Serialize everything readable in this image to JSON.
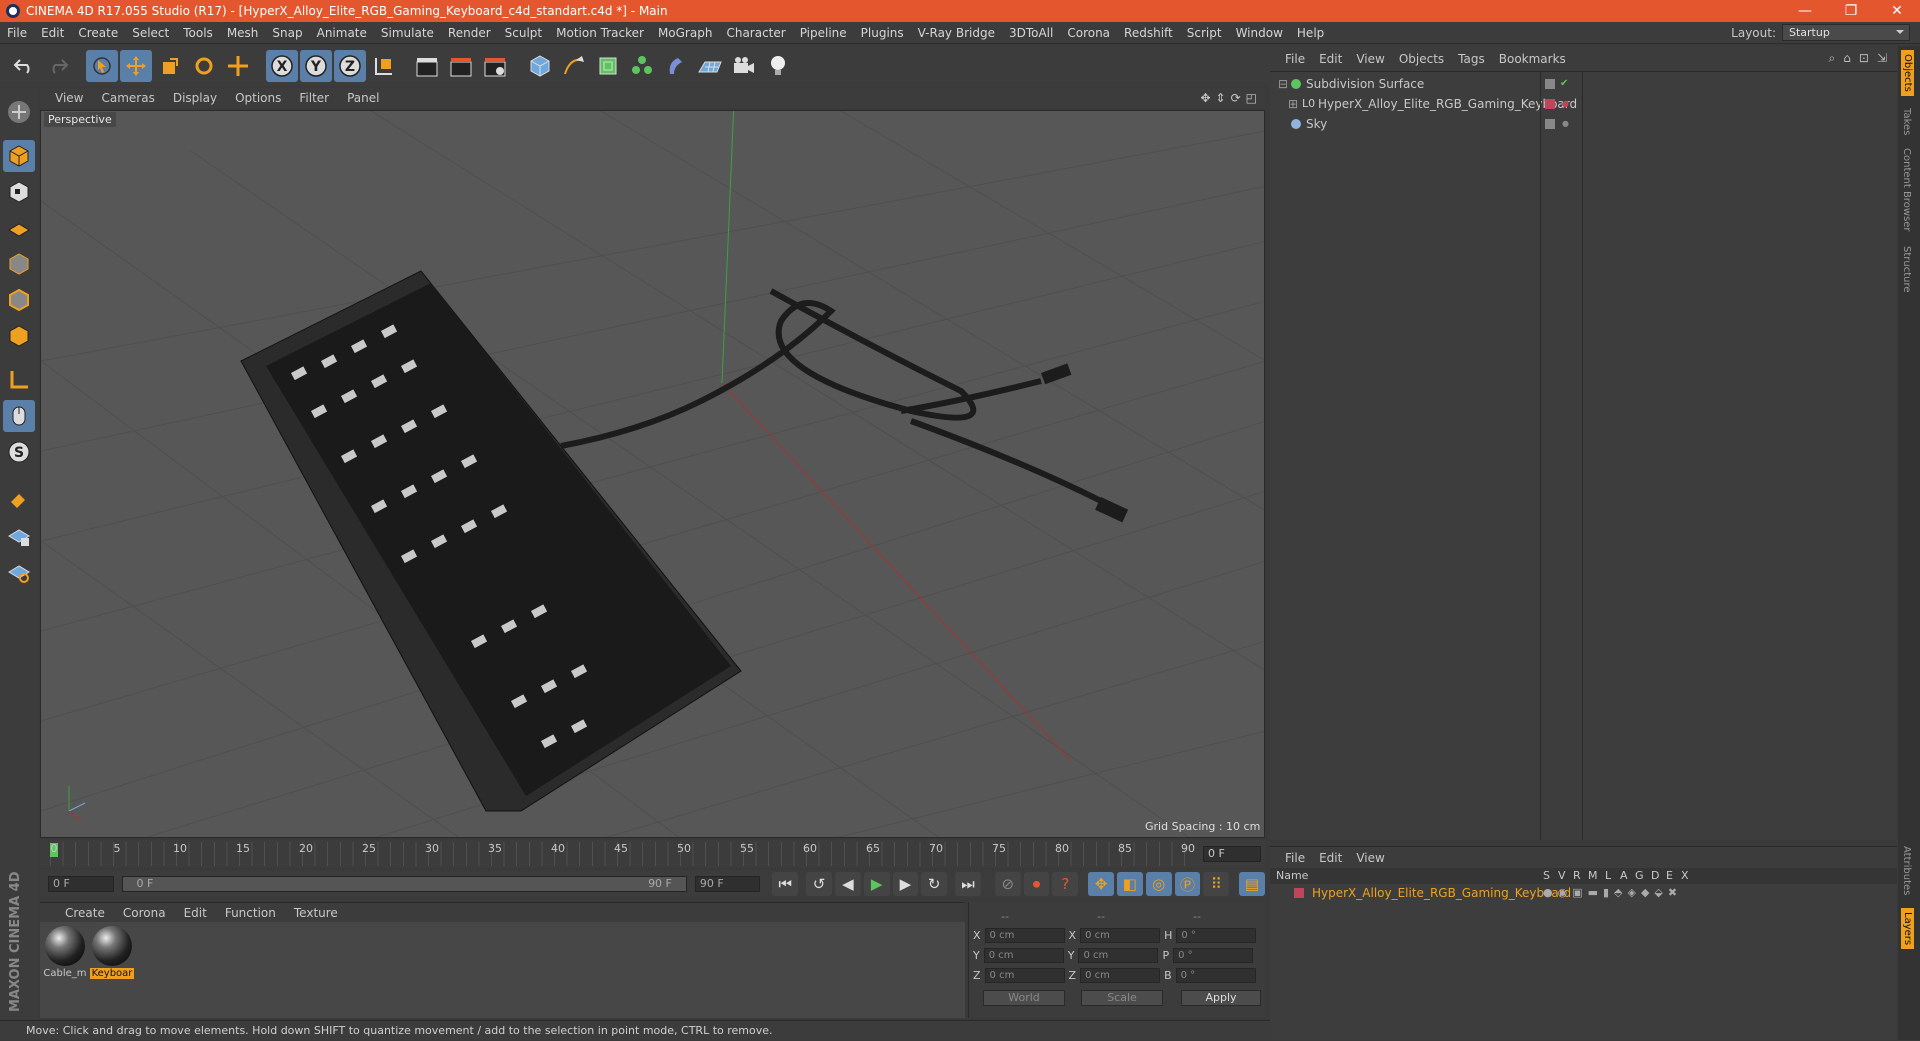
{
  "titlebar": {
    "title": "CINEMA 4D R17.055 Studio (R17) - [HyperX_Alloy_Elite_RGB_Gaming_Keyboard_c4d_standart.c4d *] - Main"
  },
  "menubar": {
    "items": [
      "File",
      "Edit",
      "Create",
      "Select",
      "Tools",
      "Mesh",
      "Snap",
      "Animate",
      "Simulate",
      "Render",
      "Sculpt",
      "Motion Tracker",
      "MoGraph",
      "Character",
      "Pipeline",
      "Plugins",
      "V-Ray Bridge",
      "3DToAll",
      "Corona",
      "Redshift",
      "Script",
      "Window",
      "Help"
    ],
    "layout_label": "Layout:",
    "layout_value": "Startup"
  },
  "viewport": {
    "menu": [
      "View",
      "Cameras",
      "Display",
      "Options",
      "Filter",
      "Panel"
    ],
    "label": "Perspective",
    "grid_spacing": "Grid Spacing : 10 cm"
  },
  "timeline": {
    "ticks": [
      "0",
      "5",
      "10",
      "15",
      "20",
      "25",
      "30",
      "35",
      "40",
      "45",
      "50",
      "55",
      "60",
      "65",
      "70",
      "75",
      "80",
      "85",
      "90"
    ],
    "frame_field": "0 F"
  },
  "transport": {
    "start": "0 F",
    "range_start": "0 F",
    "range_end": "90 F",
    "end": "90 F"
  },
  "materials": {
    "menu": [
      "Create",
      "Corona",
      "Edit",
      "Function",
      "Texture"
    ],
    "items": [
      {
        "label": "Cable_m"
      },
      {
        "label": "Keyboar"
      }
    ]
  },
  "coords": {
    "header": [
      "--",
      "--",
      "--"
    ],
    "rows": [
      {
        "a": "X",
        "av": "0 cm",
        "b": "X",
        "bv": "0 cm",
        "c": "H",
        "cv": "0 °"
      },
      {
        "a": "Y",
        "av": "0 cm",
        "b": "Y",
        "bv": "0 cm",
        "c": "P",
        "cv": "0 °"
      },
      {
        "a": "Z",
        "av": "0 cm",
        "b": "Z",
        "bv": "0 cm",
        "c": "B",
        "cv": "0 °"
      }
    ],
    "world": "World",
    "scale": "Scale",
    "apply": "Apply"
  },
  "status": "Move: Click and drag to move elements. Hold down SHIFT to quantize movement / add to the selection in point mode, CTRL to remove.",
  "maxon": "MAXON CINEMA 4D",
  "objects": {
    "menu": [
      "File",
      "Edit",
      "View",
      "Objects",
      "Tags",
      "Bookmarks"
    ],
    "tree": [
      {
        "name": "Subdivision Surface",
        "color": "#5ec45e"
      },
      {
        "name": "HyperX_Alloy_Elite_RGB_Gaming_Keyboard",
        "color": "#c0c0c0"
      },
      {
        "name": "Sky",
        "color": "#8fb4e0"
      }
    ]
  },
  "layers": {
    "menu": [
      "File",
      "Edit",
      "View"
    ],
    "head_name": "Name",
    "cols": [
      "S",
      "V",
      "R",
      "M",
      "L",
      "A",
      "G",
      "D",
      "E",
      "X"
    ],
    "row": "HyperX_Alloy_Elite_RGB_Gaming_Keyboard",
    "row_color": "#f0a020"
  },
  "right_tabs": [
    "Objects",
    "Takes",
    "Content Browser",
    "Structure",
    "Attributes",
    "Layers"
  ]
}
